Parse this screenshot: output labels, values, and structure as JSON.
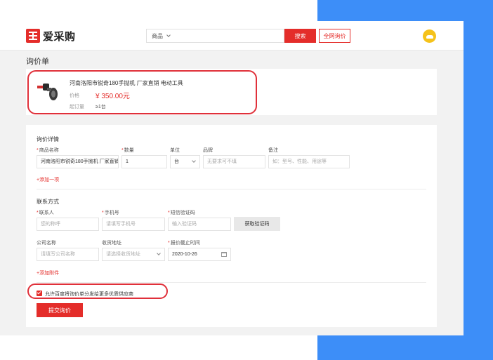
{
  "brand": {
    "name": "爱采购",
    "accent": "#e42d2a",
    "side_panel_color": "#3d8ef8"
  },
  "header": {
    "search_category": "商品",
    "search_placeholder": "",
    "search_button": "搜索",
    "global_inquiry_button": "全网询价",
    "avatar_icon": "user-avatar-icon"
  },
  "page": {
    "title": "询价单"
  },
  "product": {
    "name": "河南洛阳市锐奇180手抛机 厂家直销 电动工具",
    "price_label": "价格",
    "price": "¥ 350.00元",
    "moq_label": "起订量",
    "moq": "≥1台"
  },
  "inquiry": {
    "section_title": "询价详情",
    "labels": {
      "name": "商品名称",
      "qty": "数量",
      "unit": "单位",
      "brand": "品牌",
      "note": "备注"
    },
    "values": {
      "name": "河南洛阳市锐奇180手抛机 厂家直销",
      "qty": "1",
      "unit": "台"
    },
    "placeholders": {
      "brand": "无要求可不填",
      "note": "如：型号、性能、用途等"
    },
    "add_item": "+添加一项"
  },
  "contact": {
    "section_title": "联系方式",
    "labels": {
      "contact": "联系人",
      "phone": "手机号",
      "code": "短信验证码",
      "company": "公司名称",
      "address": "收货地址",
      "deadline": "报价截止时间"
    },
    "placeholders": {
      "contact": "您的称呼",
      "phone": "请填写手机号",
      "code": "输入验证码",
      "company": "请填写公司名称",
      "address": "请选择收货地址"
    },
    "deadline_value": "2020-10-26",
    "get_code_button": "获取验证码",
    "add_attachment": "+添加附件"
  },
  "consent": {
    "checked": true,
    "text": "允许百度将询价单分发给更多优质供应商"
  },
  "submit_button": "提交询价"
}
